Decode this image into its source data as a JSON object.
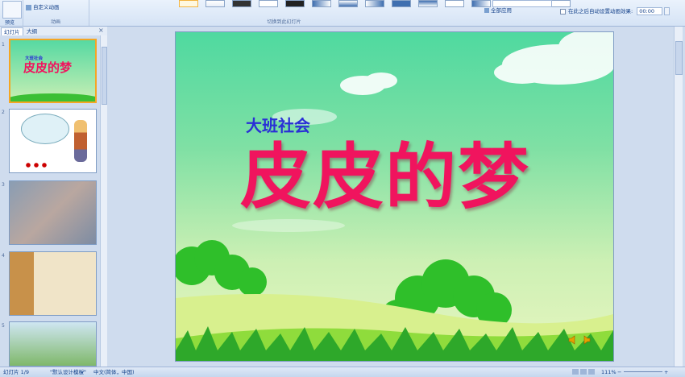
{
  "ribbon": {
    "preview_label": "预览",
    "custom_anim_label": "自定义动画",
    "group_anim": "动画",
    "group_switch": "切换到此幻灯片",
    "apply_all": "全部应用",
    "auto_after_label": "在此之后自动设置动画效果:",
    "auto_after_value": "00:00"
  },
  "left_panel": {
    "tab_slides": "幻灯片",
    "tab_outline": "大纲",
    "slide_numbers": [
      "1",
      "2",
      "3",
      "4",
      "5"
    ],
    "thumb1_subtitle": "大班社会",
    "thumb1_title": "皮皮的梦"
  },
  "slide": {
    "subtitle": "大班社会",
    "title": "皮皮的梦"
  },
  "status": {
    "slide_info": "幻灯片 1/9",
    "theme": "\"默认设计模板\"",
    "language": "中文(简体，中国)",
    "zoom": "111%"
  },
  "colors": {
    "title": "#f0145e",
    "subtitle": "#2a2fd6",
    "ribbon": "#d5e3f5"
  },
  "icons": [
    "speaker-icon",
    "check-icon",
    "close-icon",
    "zoom-minus-icon",
    "zoom-plus-icon"
  ]
}
